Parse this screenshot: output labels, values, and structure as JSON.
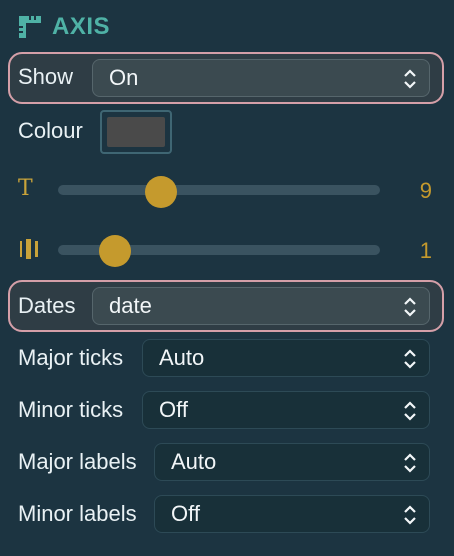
{
  "section": {
    "title": "AXIS",
    "icon": "ruler-icon"
  },
  "show": {
    "label": "Show",
    "value": "On"
  },
  "colour": {
    "label": "Colour",
    "value": "#4a4a4a"
  },
  "text_size": {
    "icon": "text-size-icon",
    "glyph": "T",
    "value": "9",
    "level": 0.32
  },
  "tick_width": {
    "icon": "line-width-icon",
    "value": "1",
    "level": 0.17
  },
  "dates": {
    "label": "Dates",
    "value": "date"
  },
  "major_ticks": {
    "label": "Major ticks",
    "value": "Auto"
  },
  "minor_ticks": {
    "label": "Minor ticks",
    "value": "Off"
  },
  "major_labels": {
    "label": "Major labels",
    "value": "Auto"
  },
  "minor_labels": {
    "label": "Minor labels",
    "value": "Off"
  },
  "colors": {
    "accent": "#4fb2a6",
    "slider": "#c59a2d",
    "highlight": "#d49fa8",
    "background": "#1c3441"
  }
}
